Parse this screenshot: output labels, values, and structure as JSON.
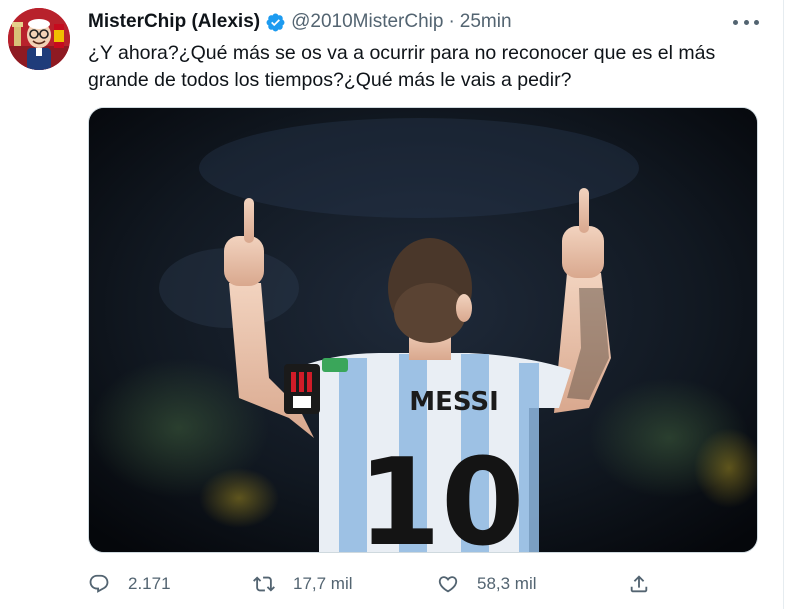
{
  "tweet": {
    "display_name": "MisterChip (Alexis)",
    "handle": "@2010MisterChip",
    "separator": "·",
    "time": "25min",
    "text": "¿Y ahora?¿Qué más se os va a ocurrir para no reconocer que es el más grande de todos los tiempos?¿Qué más le vais a pedir?",
    "verified": true,
    "image": {
      "jersey_name": "MESSI",
      "jersey_number": "10"
    }
  },
  "actions": {
    "reply_count": "2.171",
    "retweet_count": "17,7 mil",
    "like_count": "58,3 mil"
  },
  "icons": {
    "verified": "verified-badge-icon",
    "more": "more-options-icon",
    "reply": "reply-icon",
    "retweet": "retweet-icon",
    "like": "heart-icon",
    "share": "share-icon"
  },
  "colors": {
    "text_primary": "#0f1419",
    "text_secondary": "#536471",
    "verified_blue": "#1d9bf0",
    "border": "#cfd9de"
  }
}
